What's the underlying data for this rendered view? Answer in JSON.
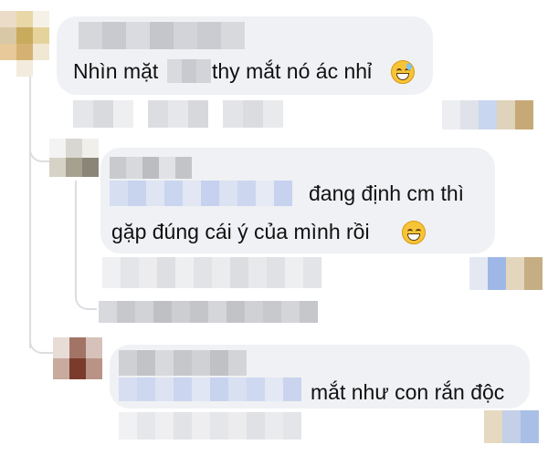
{
  "comments": [
    {
      "text_before": "Nhìn mặt",
      "text_after": "thy mắt nó ác nhỉ",
      "emoji": "grinning-sweat-icon"
    },
    {
      "text_line1": "đang định cm thì",
      "text_line2": "gặp đúng cái ý của mình rồi",
      "emoji": "grinning-icon"
    },
    {
      "text": "mắt như con rắn độc"
    }
  ],
  "colors": {
    "bubble": "#eff1f4",
    "thread_line": "#dcdde1",
    "pixelated_gray": "#cfd0d4",
    "pixelated_blue": "#cdd8f0"
  }
}
